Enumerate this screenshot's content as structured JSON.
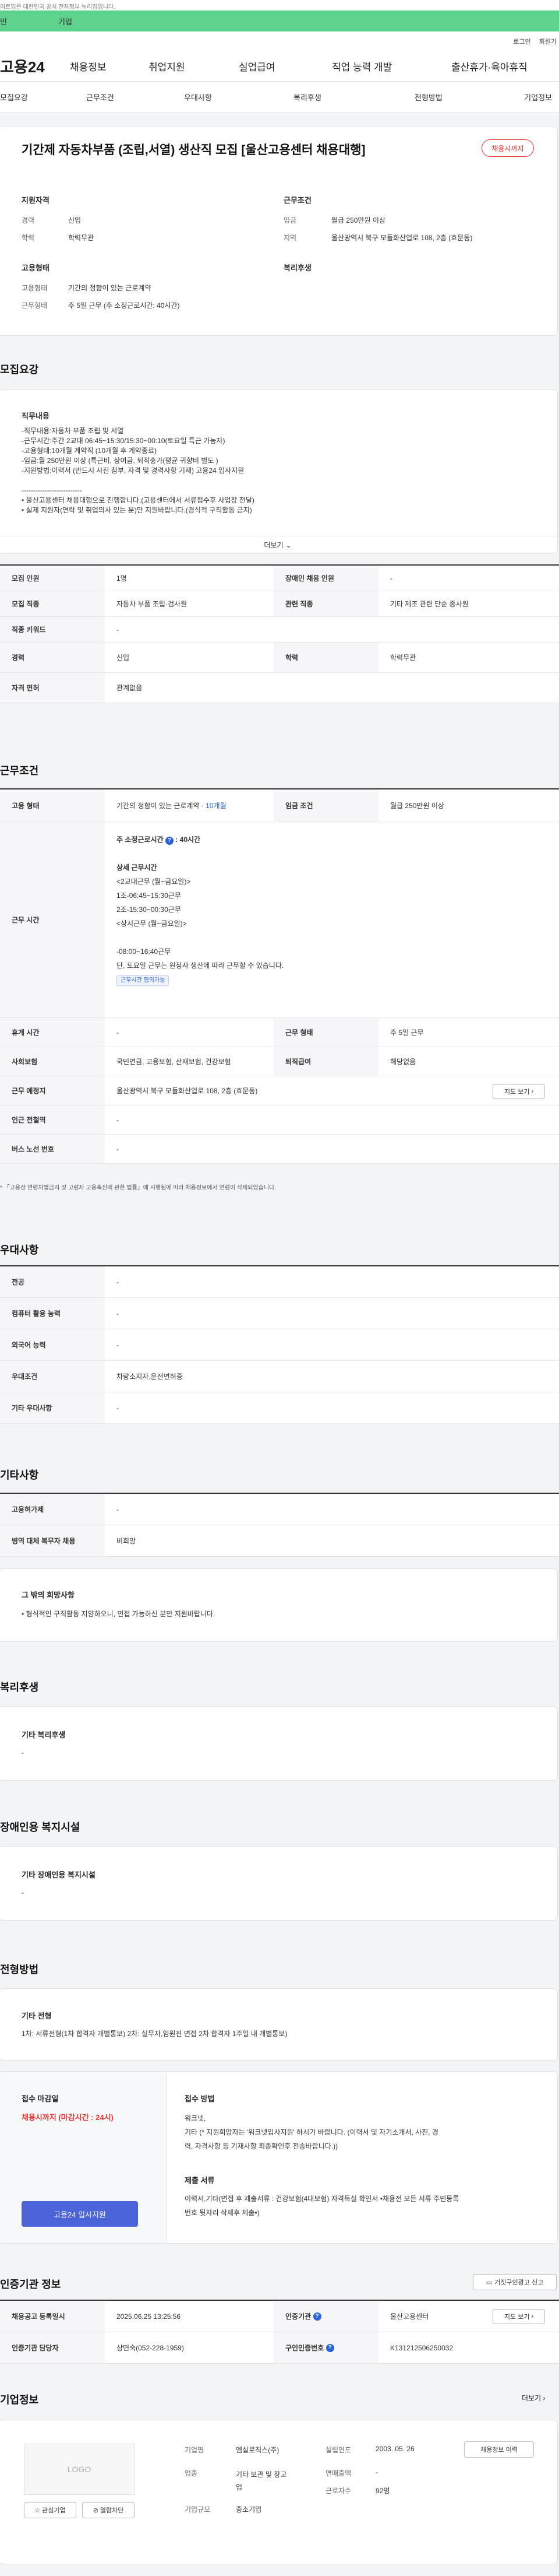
{
  "notice": "이트입은 대한민국 공식 전자정부 누리집입니다.",
  "topbar": {
    "left": "민",
    "right": "기업"
  },
  "util": {
    "login": "로그인",
    "join": "회원가"
  },
  "gnb": {
    "logo": "고용24",
    "menus": [
      "채용정보",
      "취업지원",
      "실업급여",
      "직업 능력 개발",
      "출산휴가·육아휴직"
    ]
  },
  "subnav": [
    "모집요강",
    "근무조건",
    "우대사항",
    "복리후생",
    "전형방법",
    "기업정보"
  ],
  "job": {
    "title": "기간제 자동차부품 (조립,서열) 생산직 모집 [울산고용센터 채용대행]",
    "badge": "채용시까지",
    "qual_head": "지원자격",
    "cond_head": "근무조건",
    "career_l": "경력",
    "career_v": "신입",
    "edu_l": "학력",
    "edu_v": "학력무관",
    "wage_l": "임금",
    "wage_v": "월급 250만원 이상",
    "region_l": "지역",
    "region_v": "울산광역시 북구 모듈화산업로 108, 2층 (효문동)",
    "type_head": "고용형태",
    "welfare_head": "복리후생",
    "type_l": "고용형태",
    "type_v": "기간의 정함이 있는 근로계약",
    "form_l": "근무형태",
    "form_v": "주 5일 근무 (주 소정근로시간: 40시간)"
  },
  "recruit": {
    "heading": "모집요강",
    "duty_title": "직무내용",
    "duty_lines": [
      "-직무내용:자동차 부품 조립 및 서열",
      "-근무시간:주간 2교대 06:45~15:30/15:30~00:10(토요일 특근 가능자)",
      "-고용형태:10개월 계약직 (10개월 후 계약종료)",
      "-임금:월 250만원 이상 (특근비, 상여금, 퇴직충가(평균 귀향비 별도 )",
      "-지원방법:이력서 (반드시 사진 첨부, 자격 및 경력사항 기재) 고용24 입사지원",
      "",
      "--------------------------",
      "• 울산고용센터 채용대행으로 진행합니다.(고용센터에서 서류접수후 사업장 전달)",
      "• 실제 지원자(연락 및 취업의사 있는 분)만 지원바랍니다.(경식적 구직활동 금지)"
    ],
    "more": "더보기",
    "rows": [
      {
        "l1": "모집 인원",
        "v1": "1명",
        "l2": "장애인 채용 인원",
        "v2": "-"
      },
      {
        "l1": "모집 직종",
        "v1": "자동차 부품 조립·검사원",
        "l2": "관련 직종",
        "v2": "기타 제조 관련 단순 종사원"
      },
      {
        "l1": "직종 키워드",
        "v1": "-",
        "l2": "",
        "v2": ""
      },
      {
        "l1": "경력",
        "v1": "신입",
        "l2": "학력",
        "v2": "학력무관"
      },
      {
        "l1": "자격 면허",
        "v1": "관계없음",
        "l2": "",
        "v2": ""
      }
    ]
  },
  "workcond": {
    "heading": "근무조건",
    "type_l": "고용 형태",
    "type_v": "기간의 정함이 있는 근로계약 · ",
    "type_v2": "10개월",
    "wage_l": "임금 조건",
    "wage_v": "월급 250만원 이상",
    "time_l": "근무 시간",
    "time_head": "주 소정근로시간",
    "time_hours": ": 40시간",
    "detail_title": "상세 근무시간",
    "detail_lines": [
      "<2교대근무 (월~금요일)>",
      "1조-06:45~15:30근무",
      "2조-15:30~00:30근무",
      "<상시근무 (월~금요일)>",
      "",
      "-08:00~16:40근무",
      "단, 토요일 근무는 원청사 생산에 따라 근무할 수 있습니다."
    ],
    "flex_tag": "근무시간 협의가능",
    "rest_l": "휴게 시간",
    "rest_v": "-",
    "form_l": "근무 형태",
    "form_v": "주 5일 근무",
    "ins_l": "사회보험",
    "ins_v": "국민연금, 고용보험, 산재보험, 건강보험",
    "ret_l": "퇴직급여",
    "ret_v": "해당없음",
    "place_l": "근무 예정지",
    "place_v": "울산광역시 북구 모듈화산업로 108, 2층 (효문동)",
    "map_btn": "지도 보기",
    "sub_l": "인근 전철역",
    "sub_v": "-",
    "bus_l": "버스 노선 번호",
    "bus_v": "-",
    "note": "* 「고용상 연령차별금지 및 고령자 고용촉진에 관한 법률」에 시행됨에 따라 채용정보에서 연령이 삭제되었습니다."
  },
  "pref": {
    "heading": "우대사항",
    "rows": [
      {
        "l": "전공",
        "v": "-"
      },
      {
        "l": "컴퓨터 활용 능력",
        "v": "-"
      },
      {
        "l": "외국어 능력",
        "v": "-"
      },
      {
        "l": "우대조건",
        "v": "차량소지자,운전면허증"
      },
      {
        "l": "기타 우대사항",
        "v": "-"
      }
    ]
  },
  "etc": {
    "heading": "기타사항",
    "rows": [
      {
        "l": "고용허가제",
        "v": "-"
      },
      {
        "l": "병역 대체 복무자 채용",
        "v": "비희망"
      }
    ],
    "box_title": "그 밖의 희망사항",
    "box_text": "• 형식적인 구직활동 지양하오니, 면접 가능하신 분만 지원바랍니다."
  },
  "welfare": {
    "heading": "복리후생",
    "title": "기타 복리후생",
    "value": "-"
  },
  "disab": {
    "heading": "장애인용 복지시설",
    "title": "기타 장애인용 복지시설",
    "value": "-"
  },
  "screen": {
    "heading": "전형방법",
    "etc_title": "기타 전형",
    "etc_text": "1차: 서류전형(1차 합격자 개별통보) 2차: 실무자,임원진 면접 2차 합격자 1주일 내 개별통보)",
    "dead_title": "접수 마감일",
    "dead_value": "채용시까지 (마감시간 : 24시)",
    "apply_btn": "고용24 입사지원",
    "method_title": "접수 방법",
    "method_lines": [
      "워크넷,",
      "기타 (* 지원희망자는 '워크넷입사지원' 하시기 바랍니다.   (이력서 및 자기소개서, 사진, 경",
      "력, 자격사항 등 기재사항 최종확인후 전송바랍니다.))"
    ],
    "docs_title": "제출 서류",
    "docs_lines": [
      "이력서,기타(면접 후 제출서류 : 건강보험(4대보험) 자격득실 확인서 •채용전 모든 서류 주민등록",
      "번호 뒷자리 삭제후 제출•)"
    ]
  },
  "agency": {
    "heading": "인증기관 정보",
    "report_btn": "거짓구인광고 신고",
    "reg_l": "채용공고 등록일시",
    "reg_v": "2025.06.25 13:25:56",
    "org_l": "인증기관",
    "org_v": "울산고용센터",
    "map_btn": "지도 보기",
    "mgr_l": "인증기관 담당자",
    "mgr_v": "상면숙(052-228-1959)",
    "no_l": "구인인증번호",
    "no_v": "K131212506250032"
  },
  "company": {
    "heading": "기업정보",
    "more": "더보기",
    "logo": "LOGO",
    "fav_btn": "관심기업",
    "block_btn": "열람차단",
    "name_l": "기업명",
    "name_v": "엠실로직스(주)",
    "ind_l": "업종",
    "ind_v1": "기타 보관 및 창고",
    "ind_v2": "업",
    "size_l": "기업규모",
    "size_v": "중소기업",
    "est_l": "설립연도",
    "est_v": "2003. 05. 26",
    "sales_l": "연매출액",
    "sales_v": "-",
    "emp_l": "근로자수",
    "emp_v": "92명",
    "jobs_btn": "채용정보 이력"
  }
}
